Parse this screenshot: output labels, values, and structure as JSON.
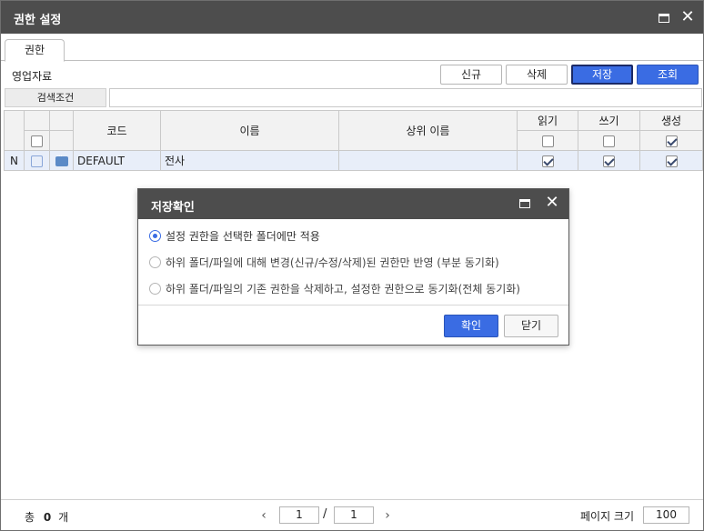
{
  "window": {
    "title": "권한 설정"
  },
  "tabs": [
    {
      "label": "권한"
    }
  ],
  "toolbar": {
    "label": "영업자료",
    "new_label": "신규",
    "delete_label": "삭제",
    "save_label": "저장",
    "query_label": "조회"
  },
  "search": {
    "label": "검색조건",
    "value": ""
  },
  "grid": {
    "headers": {
      "code": "코드",
      "name": "이름",
      "parent": "상위 이름",
      "read": "읽기",
      "write": "쓰기",
      "create": "생성"
    },
    "header_checks": {
      "read": false,
      "write": false,
      "create": true
    },
    "rows": [
      {
        "status": "N",
        "code": "DEFAULT",
        "name": "전사",
        "parent": "",
        "read": true,
        "write": true,
        "create": true
      }
    ]
  },
  "footer": {
    "total_label": "총",
    "total_count": "0",
    "total_unit": "개",
    "page_current": "1",
    "page_separator": "/",
    "page_total": "1",
    "page_size_label": "페이지 크기",
    "page_size": "100"
  },
  "dialog": {
    "title": "저장확인",
    "options": [
      {
        "label": "설정 권한을 선택한 폴더에만 적용",
        "selected": true
      },
      {
        "label": "하위 폴더/파일에 대해 변경(신규/수정/삭제)된 권한만 반영 (부분 동기화)",
        "selected": false
      },
      {
        "label": "하위 폴더/파일의 기존 권한을 삭제하고, 설정한 권한으로 동기화(전체 동기화)",
        "selected": false
      }
    ],
    "confirm_label": "확인",
    "close_label": "닫기"
  },
  "colors": {
    "titlebar": "#4d4d4d",
    "primary": "#3a6ce3",
    "row_highlight": "#e8eef9"
  }
}
